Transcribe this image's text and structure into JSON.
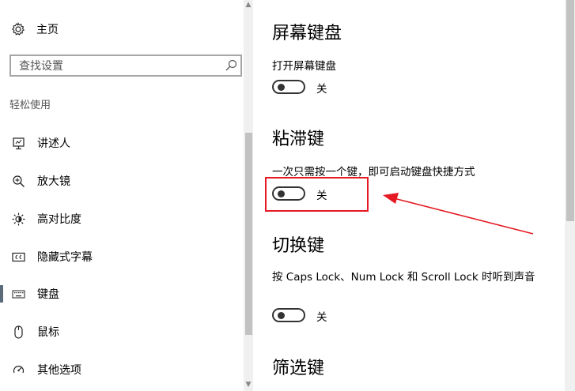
{
  "sidebar": {
    "home_label": "主页",
    "search_placeholder": "查找设置",
    "section_label": "轻松使用",
    "items": [
      {
        "label": "讲述人",
        "icon": "narrator-icon"
      },
      {
        "label": "放大镜",
        "icon": "magnifier-icon"
      },
      {
        "label": "高对比度",
        "icon": "contrast-icon"
      },
      {
        "label": "隐藏式字幕",
        "icon": "closed-caption-icon"
      },
      {
        "label": "键盘",
        "icon": "keyboard-icon",
        "active": true
      },
      {
        "label": "鼠标",
        "icon": "mouse-icon"
      },
      {
        "label": "其他选项",
        "icon": "other-options-icon"
      }
    ]
  },
  "main": {
    "onscreen_keyboard": {
      "title": "屏幕键盘",
      "desc": "打开屏幕键盘",
      "state": "关"
    },
    "sticky_keys": {
      "title": "粘滞键",
      "desc": "一次只需按一个键，即可启动键盘快捷方式",
      "state": "关"
    },
    "toggle_keys": {
      "title": "切换键",
      "desc": "按 Caps Lock、Num Lock 和 Scroll Lock 时听到声音",
      "state": "关"
    },
    "filter_keys": {
      "title": "筛选键"
    }
  },
  "colors": {
    "highlight": "#e51a23",
    "active_bar": "#5b6b7a"
  }
}
